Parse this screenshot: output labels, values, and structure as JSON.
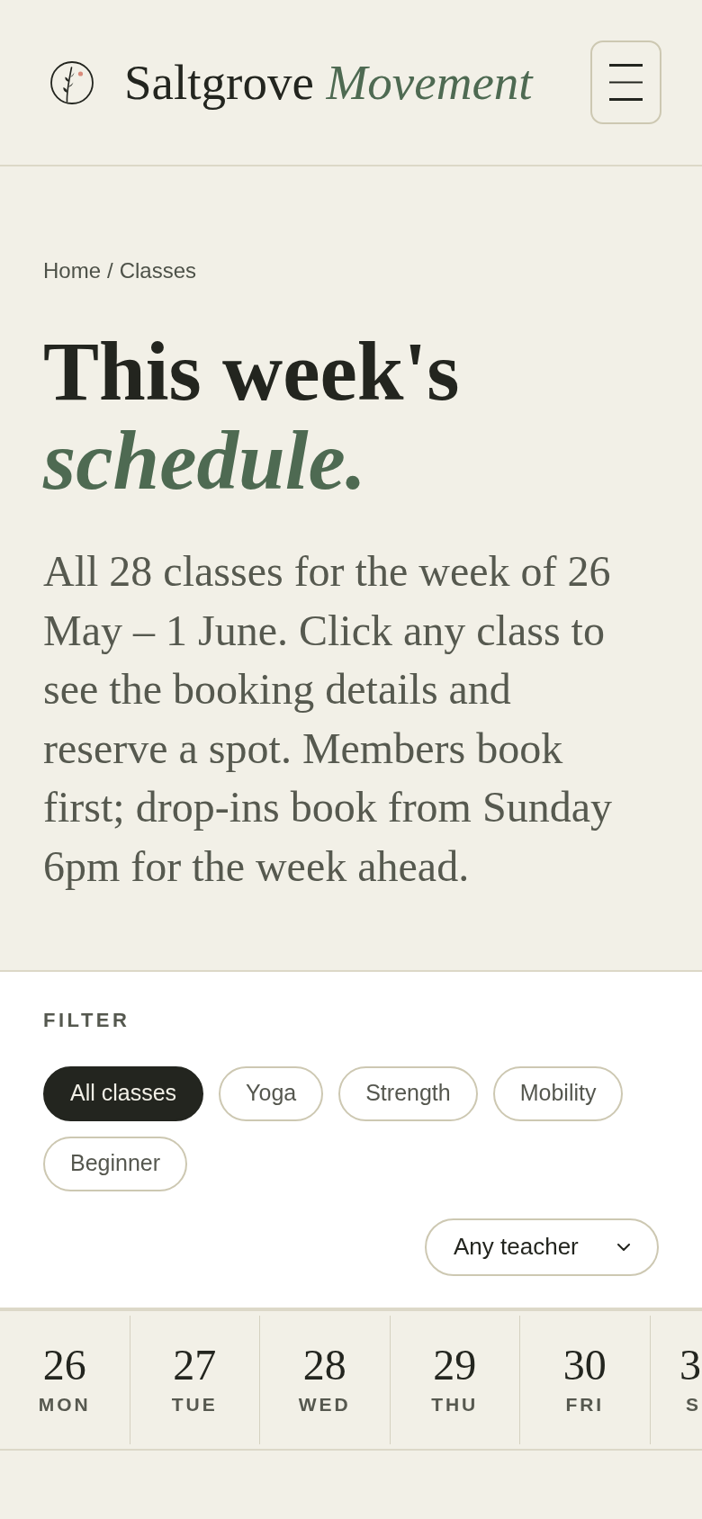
{
  "header": {
    "brand": "Saltgrove *Movement*"
  },
  "breadcrumb": {
    "items": [
      "Home",
      "Classes"
    ],
    "separator": "/"
  },
  "hero": {
    "title": "This week's *schedule.*",
    "intro": "All 28 classes for the week of 26 May – 1 June. Click any class to see the booking details and reserve a spot. Members book first; drop-ins book from Sunday 6pm for the week ahead."
  },
  "filter": {
    "label": "FILTER",
    "chips": [
      {
        "label": "All classes",
        "selected": true
      },
      {
        "label": "Yoga",
        "selected": false
      },
      {
        "label": "Strength",
        "selected": false
      },
      {
        "label": "Mobility",
        "selected": false
      },
      {
        "label": "Beginner",
        "selected": false
      }
    ],
    "teacher_select": {
      "value": "Any teacher"
    }
  },
  "days": [
    {
      "date": "26",
      "weekday": "MON"
    },
    {
      "date": "27",
      "weekday": "TUE"
    },
    {
      "date": "28",
      "weekday": "WED"
    },
    {
      "date": "29",
      "weekday": "THU"
    },
    {
      "date": "30",
      "weekday": "FRI"
    },
    {
      "date": "3",
      "weekday": "S"
    }
  ]
}
